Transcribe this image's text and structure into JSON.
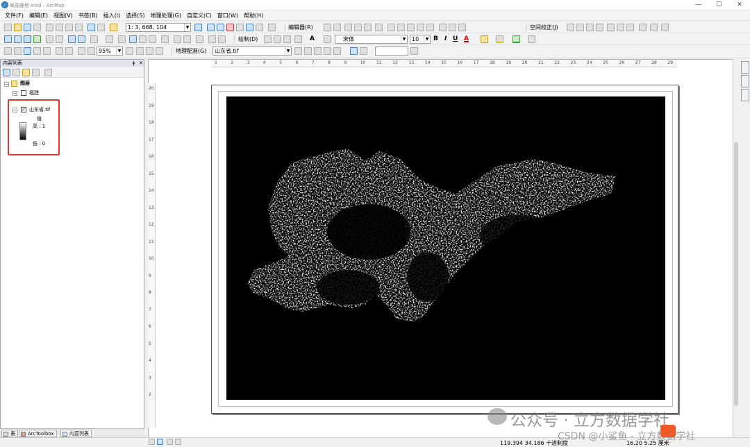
{
  "window": {
    "title": "局部栅格.mxd - ArcMap",
    "min": "—",
    "max": "☐",
    "close": "✕"
  },
  "menu": [
    "文件(F)",
    "编辑(E)",
    "视图(V)",
    "书签(B)",
    "插入(I)",
    "选择(S)",
    "地理处理(G)",
    "自定义(C)",
    "窗口(W)",
    "帮助(H)"
  ],
  "toolbar1": {
    "scale": "1: 3, 668, 104",
    "editor_label": "编辑器(R)",
    "georef_right": "空间校正(J)"
  },
  "toolbar2": {
    "zoom": "95%",
    "draw_label": "绘制(D)",
    "font": "宋体",
    "size": "10",
    "bold": "B",
    "italic": "I",
    "underline": "U",
    "text_a": "A"
  },
  "toolbar3": {
    "georef_label": "地理配准(G)",
    "layer": "山东省.tif"
  },
  "toc": {
    "title": "内容列表",
    "pin": "ǂ",
    "layers_label": "图层",
    "layer1": "福建",
    "layer2": "山东省.tif",
    "value_label": "值",
    "high": "高 : 1",
    "low": "低 : 0"
  },
  "bottom_tabs": [
    "表",
    "ArcToolbox",
    "内容列表"
  ],
  "status": {
    "coords": "119.394  34.186 十进制度",
    "page": "16.20  5.25 厘米"
  },
  "watermark": {
    "main": "公众号 · 立方数据学社",
    "csdn": "CSDN @小鲨鱼 - 立方数据学社"
  },
  "ruler_h": [
    "1",
    "2",
    "3",
    "4",
    "5",
    "6",
    "7",
    "8",
    "9",
    "10",
    "11",
    "12",
    "13",
    "14",
    "15",
    "16",
    "17",
    "18",
    "19",
    "20",
    "21",
    "22",
    "23",
    "24",
    "25",
    "26",
    "27",
    "28",
    "29"
  ],
  "ruler_v": [
    "20",
    "19",
    "18",
    "17",
    "16",
    "15",
    "14",
    "13",
    "12",
    "11",
    "10",
    "9",
    "8",
    "7",
    "6",
    "5",
    "4",
    "3",
    "2"
  ]
}
